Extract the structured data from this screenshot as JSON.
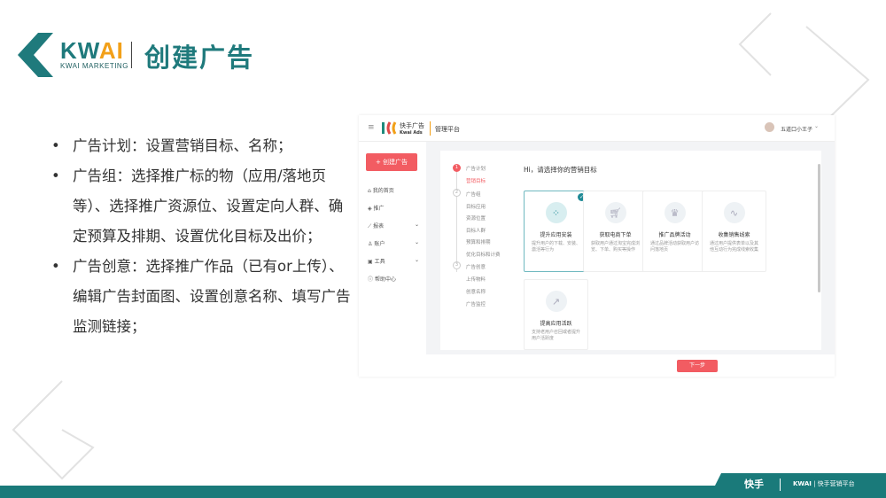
{
  "slide": {
    "brand": "KWAI",
    "brand_ai": "AI",
    "brand_prefix": "KW",
    "brand_sub": "KWAI MARKETING",
    "title": "创建广告",
    "bullets": [
      "广告计划：设置营销目标、名称；",
      "广告组：选择推广标的物（应用/落地页等）、选择推广资源位、设置定向人群、确定预算及排期、设置优化目标及出价；",
      "广告创意：选择推广作品（已有or上传）、编辑广告封面图、设置创意名称、填写广告监测链接；"
    ],
    "footer_left": "快手",
    "footer_kwai": "KWAI",
    "footer_right": "快手营销平台"
  },
  "app": {
    "logo_cn": "快手广告",
    "logo_en": "Kwai Ads",
    "platform": "管理平台",
    "user": "五道口小王子",
    "create_button": "+ 创建广告",
    "nav": [
      {
        "label": "我的首页",
        "icon": "home-icon"
      },
      {
        "label": "推广",
        "icon": "layers-icon"
      },
      {
        "label": "报表",
        "icon": "chart-icon"
      },
      {
        "label": "账户",
        "icon": "user-icon"
      },
      {
        "label": "工具",
        "icon": "toolbox-icon"
      },
      {
        "label": "帮助中心",
        "icon": "help-icon"
      }
    ],
    "steps": [
      {
        "num": "1",
        "label": "广告计划",
        "subs": [
          "营销目标"
        ]
      },
      {
        "num": "2",
        "label": "广告组",
        "subs": [
          "目标应用",
          "资源位置",
          "目标人群",
          "预算和排期",
          "优化目标和计费"
        ]
      },
      {
        "num": "3",
        "label": "广告创意",
        "subs": [
          "上传物料",
          "创意名称",
          "广告监控"
        ]
      }
    ],
    "heading": "Hi，请选择你的营销目标",
    "cards": [
      {
        "title": "提升应用安装",
        "desc": "提升用户的下载、安装、激活等行为",
        "icon": "app-grid-icon",
        "selected": true
      },
      {
        "title": "获取电商下单",
        "desc": "获取用户通过淘宝完成浏览、下单、购买等操作",
        "icon": "cart-icon"
      },
      {
        "title": "推广品牌活动",
        "desc": "通过品牌活动获取用户访问落地页",
        "icon": "crown-icon"
      },
      {
        "title": "收集销售线索",
        "desc": "通过用户提供表单以及其他互动行为完成线索收集",
        "icon": "path-icon"
      },
      {
        "title": "提高应用活跃",
        "desc": "支持老用户召回或者提升用户活跃度",
        "icon": "trend-icon"
      }
    ],
    "next": "下一步"
  }
}
